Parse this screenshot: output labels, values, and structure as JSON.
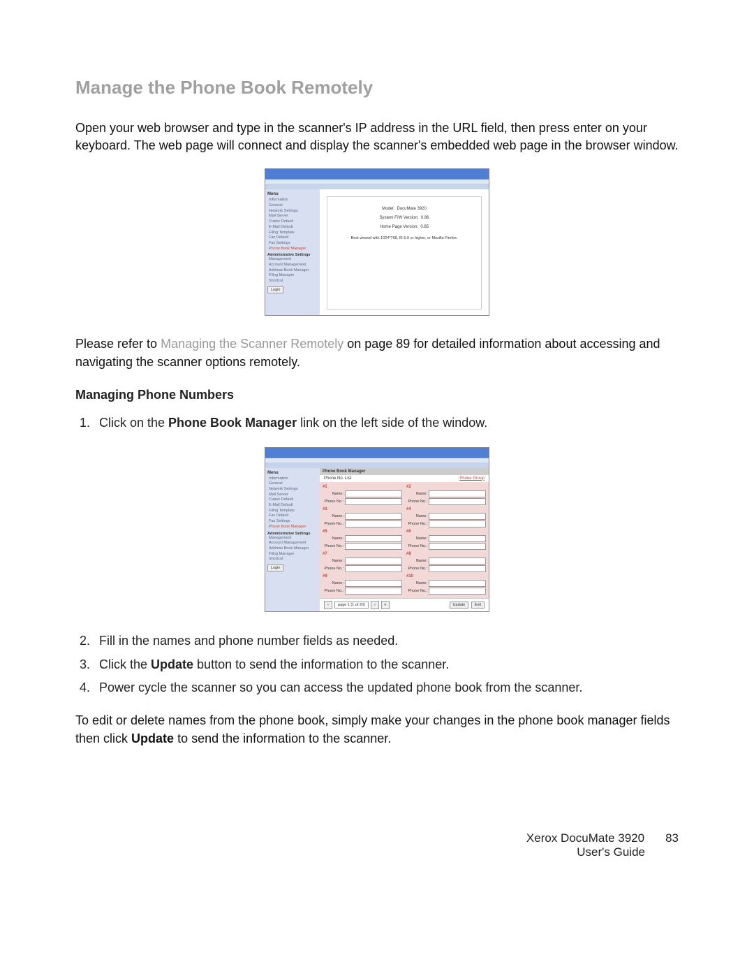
{
  "title": "Manage the Phone Book Remotely",
  "intro": "Open your web browser and type in the scanner's IP address in the URL field, then press enter on your keyboard. The web page will connect and display the scanner's embedded web page in the browser window.",
  "refer_prefix": "Please refer to ",
  "refer_link": "Managing the Scanner Remotely",
  "refer_suffix": " on page 89 for detailed information about accessing and navigating the scanner options remotely.",
  "sub_title": "Managing Phone Numbers",
  "step1_pre": "Click on the ",
  "step1_bold": "Phone Book Manager",
  "step1_post": " link on the left side of the window.",
  "step2": "Fill in the names and phone number fields as needed.",
  "step3_pre": "Click the ",
  "step3_bold": "Update",
  "step3_post": " button to send the information to the scanner.",
  "step4": "Power cycle the scanner so you can access the updated phone book from the scanner.",
  "closing_pre": "To edit or delete names from the phone book, simply make your changes in the phone book manager fields then click ",
  "closing_bold": "Update",
  "closing_post": " to send the information to the scanner.",
  "footer_product": "Xerox DocuMate 3920",
  "footer_page": "83",
  "footer_doc": "User's Guide",
  "ss1": {
    "menu_label": "Menu",
    "items_info": [
      "Information",
      "General",
      "Network Settings",
      "Mail Server",
      "Copier Default",
      "E-Mail Default",
      "Filing Template",
      "Fax Default",
      "Fax Settings",
      "Phone Book Manager"
    ],
    "sect_admin": "Administrative Settings",
    "items_admin": [
      "Management",
      "Account Management",
      "Address Book Manager",
      "Filing Manager",
      "Shortcut"
    ],
    "login": "Login",
    "model_label": "Model:",
    "model_value": "DocuMate 3920",
    "fw_label": "System F/W Version:",
    "fw_value": "0.86",
    "hp_label": "Home Page Version:",
    "hp_value": "0.85",
    "note": "Best viewed with 1024*768, IE 5.0 or higher, or Mozilla Firefox."
  },
  "ss2": {
    "menu_label": "Menu",
    "items_info": [
      "Information",
      "General",
      "Network Settings",
      "Mail Server",
      "Copier Default",
      "E-Mail Default",
      "Filing Template",
      "Fax Default",
      "Fax Settings",
      "Phone Book Manager"
    ],
    "sect_admin": "Administrative Settings",
    "items_admin": [
      "Management",
      "Account Management",
      "Address Book Manager",
      "Filing Manager",
      "Shortcut"
    ],
    "login": "Login",
    "header": "Phone Book Manager",
    "sub_left": "Phone No. List",
    "sub_right": "Phone Group",
    "nums": [
      "#1",
      "#2",
      "#3",
      "#4",
      "#5",
      "#6",
      "#7",
      "#8",
      "#9",
      "#10"
    ],
    "lbl_name": "Name:",
    "lbl_phone": "Phone No.:",
    "pager_text": "page 1 (1 of 20)",
    "btn_update": "Update",
    "btn_exit": "Exit"
  }
}
